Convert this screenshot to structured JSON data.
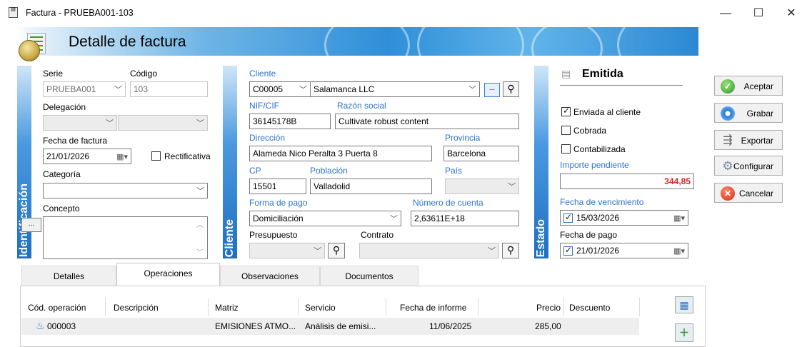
{
  "window": {
    "title": "Factura - PRUEBA001-103",
    "minimize": "—",
    "maximize": "☐",
    "close": "✕"
  },
  "header": {
    "title": "Detalle de factura"
  },
  "sections": {
    "identificacion": "Identificación",
    "cliente": "Cliente",
    "estado": "Estado"
  },
  "ident": {
    "serie_label": "Serie",
    "serie_value": "PRUEBA001",
    "codigo_label": "Código",
    "codigo_value": "103",
    "delegacion_label": "Delegación",
    "fecha_label": "Fecha de factura",
    "fecha_value": "21/01/2026",
    "rectificativa_label": "Rectificativa",
    "categoria_label": "Categoría",
    "concepto_label": "Concepto",
    "ellipsis": "..."
  },
  "cliente": {
    "cliente_label": "Cliente",
    "cliente_code": "C00005",
    "cliente_name": "Salamanca LLC",
    "ellipsis": "...",
    "nif_label": "NIF/CIF",
    "nif_value": "36145178B",
    "razon_label": "Razón social",
    "razon_value": "Cultivate robust content",
    "direccion_label": "Dirección",
    "direccion_value": "Alameda Nico Peralta 3 Puerta 8",
    "provincia_label": "Provincia",
    "provincia_value": "Barcelona",
    "cp_label": "CP",
    "cp_value": "15501",
    "poblacion_label": "Población",
    "poblacion_value": "Valladolid",
    "pais_label": "País",
    "forma_label": "Forma de pago",
    "forma_value": "Domiciliación",
    "cuenta_label": "Número de cuenta",
    "cuenta_value": "2,63611E+18",
    "presupuesto_label": "Presupuesto",
    "contrato_label": "Contrato"
  },
  "estado": {
    "status": "Emitida",
    "enviada_label": "Enviada al cliente",
    "enviada_checked": true,
    "cobrada_label": "Cobrada",
    "contabilizada_label": "Contabilizada",
    "importe_label": "Importe pendiente",
    "importe_value": "344,85",
    "vencimiento_label": "Fecha de vencimiento",
    "vencimiento_value": "15/03/2026",
    "pago_label": "Fecha de pago",
    "pago_value": "21/01/2026"
  },
  "actions": {
    "aceptar": "Aceptar",
    "grabar": "Grabar",
    "exportar": "Exportar",
    "configurar": "Configurar",
    "cancelar": "Cancelar"
  },
  "tabs": [
    "Detalles",
    "Operaciones",
    "Observaciones",
    "Documentos"
  ],
  "grid": {
    "columns": [
      "Cód. operación",
      "Descripción",
      "Matriz",
      "Servicio",
      "Fecha de informe",
      "Precio",
      "Descuento"
    ],
    "rows": [
      {
        "codigo": "000003",
        "descripcion": "",
        "matriz": "EMISIONES ATMO...",
        "servicio": "Análisis de emisi...",
        "fecha": "11/06/2025",
        "precio": "285,00",
        "descuento": ""
      }
    ]
  }
}
